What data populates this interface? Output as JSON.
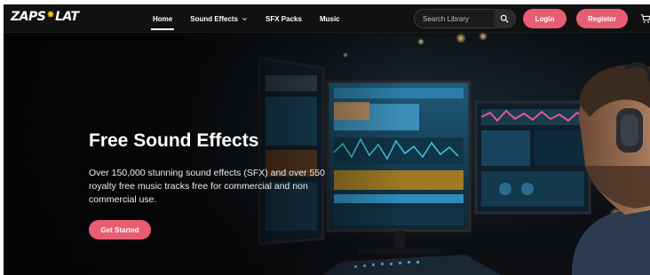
{
  "brand": {
    "name": "ZAPSPLAT"
  },
  "nav": {
    "links": [
      {
        "label": "Home",
        "active": true
      },
      {
        "label": "Sound Effects",
        "has_dropdown": true
      },
      {
        "label": "SFX Packs"
      },
      {
        "label": "Music"
      }
    ],
    "search": {
      "placeholder": "Search Library"
    },
    "login_label": "Login",
    "register_label": "Register"
  },
  "hero": {
    "title": "Free Sound Effects",
    "description": "Over 150,000 stunning sound effects (SFX) and over 550 royalty free music tracks free for commercial and non commercial use.",
    "cta_label": "Get Started"
  },
  "colors": {
    "accent": "#e85d72",
    "nav_bg": "#111112",
    "hero_bg": "#0b0b0c"
  },
  "icons": [
    "search-icon",
    "chevron-down-icon",
    "cart-icon",
    "logo-star-icon"
  ]
}
